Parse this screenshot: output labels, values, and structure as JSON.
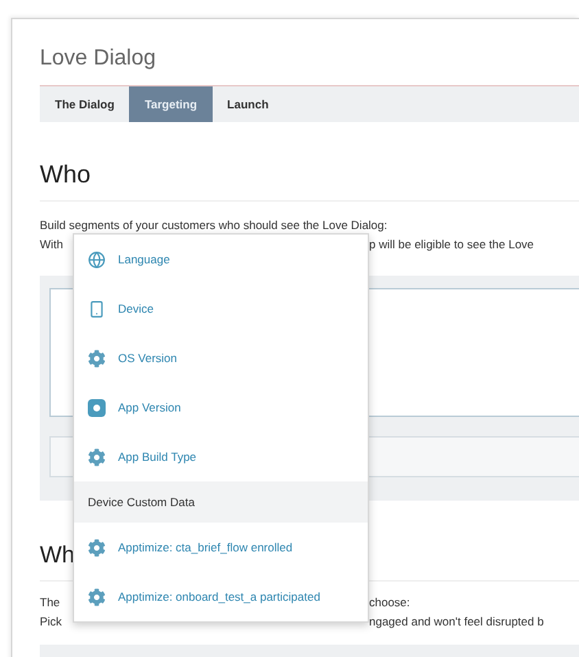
{
  "page": {
    "title": "Love Dialog"
  },
  "tabs": [
    {
      "label": "The Dialog",
      "selected": false
    },
    {
      "label": "Targeting",
      "selected": true
    },
    {
      "label": "Launch",
      "selected": false
    }
  ],
  "who": {
    "heading": "Who",
    "line_1": "Build segments of your customers who should see the Love Dialog:",
    "line_2_start": "With",
    "line_2_end": "p will be eligible to see the Love"
  },
  "when": {
    "heading": "Wh",
    "line_1_start": "The",
    "line_1_end": "choose:",
    "line_2_start": "Pick",
    "line_2_end": "ngaged and won't feel disrupted b"
  },
  "menu": [
    {
      "kind": "language",
      "label": "Language"
    },
    {
      "kind": "device",
      "label": "Device"
    },
    {
      "kind": "os",
      "label": "OS Version"
    },
    {
      "kind": "app",
      "label": "App Version"
    },
    {
      "kind": "build",
      "label": "App Build Type"
    },
    {
      "kind": "header",
      "label": "Device Custom Data"
    },
    {
      "kind": "custom",
      "label": "Apptimize: cta_brief_flow enrolled"
    },
    {
      "kind": "custom",
      "label": "Apptimize: onboard_test_a participated"
    }
  ]
}
